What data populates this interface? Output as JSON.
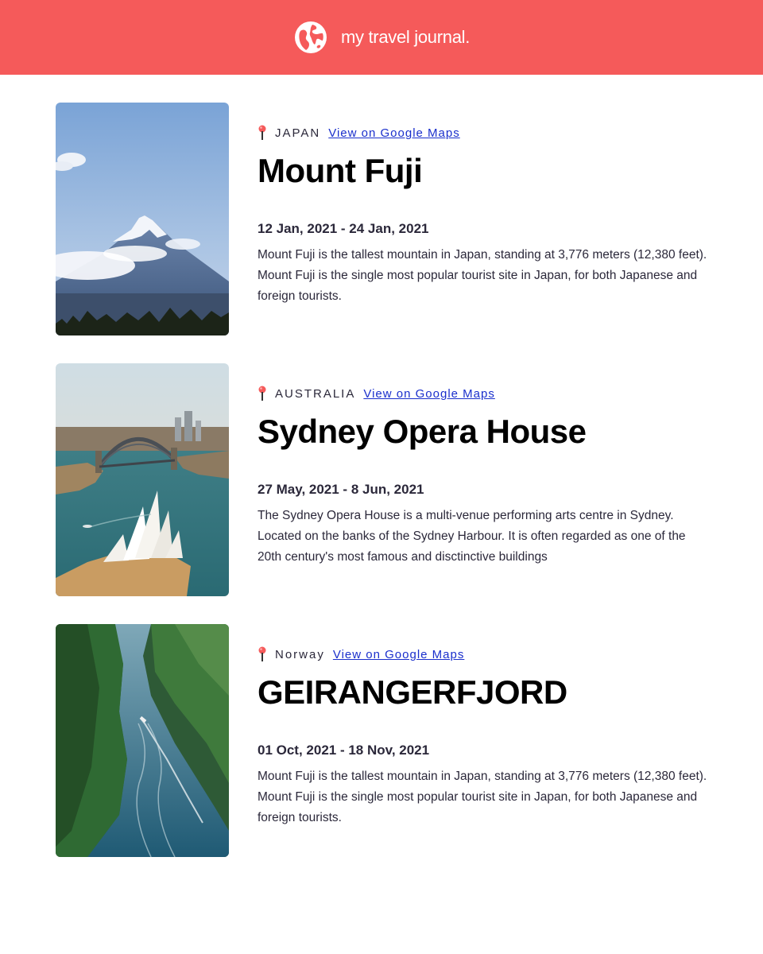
{
  "header": {
    "title": "my travel journal.",
    "icon": "globe-icon",
    "background": "#F55A5A"
  },
  "entries": [
    {
      "photo": "mount-fuji-photo",
      "country": "JAPAN",
      "maps_link": "View on Google Maps",
      "place": "Mount Fuji",
      "dates": "12 Jan, 2021 - 24 Jan, 2021",
      "description": "Mount Fuji is the tallest mountain in Japan, standing at 3,776 meters (12,380 feet). Mount Fuji is the single most popular tourist site in Japan, for both Japanese and foreign tourists."
    },
    {
      "photo": "sydney-opera-house-photo",
      "country": "AUSTRALIA",
      "maps_link": "View on Google Maps",
      "place": "Sydney Opera House",
      "dates": "27 May, 2021 - 8 Jun, 2021",
      "description": "The Sydney Opera House is a multi-venue performing arts centre in Sydney. Located on the banks of the Sydney Harbour. It is often regarded as one of the 20th century's most famous and disctinctive buildings"
    },
    {
      "photo": "geirangerfjord-photo",
      "country": "Norway",
      "maps_link": "View on Google Maps",
      "place": "GEIRANGERFJORD",
      "dates": "01 Oct, 2021 - 18 Nov, 2021",
      "description": "Mount Fuji is the tallest mountain in Japan, standing at 3,776 meters (12,380 feet). Mount Fuji is the single most popular tourist site in Japan, for both Japanese and foreign tourists."
    }
  ]
}
